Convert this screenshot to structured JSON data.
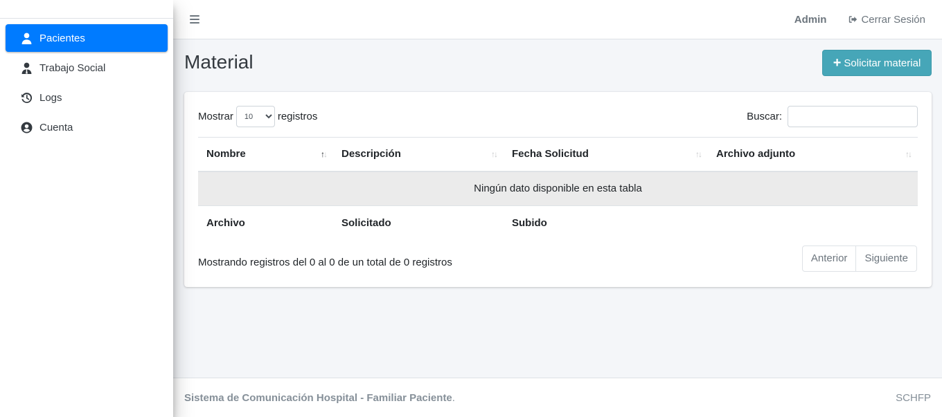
{
  "sidebar": {
    "items": [
      {
        "label": "Pacientes",
        "icon": "user-icon",
        "active": true
      },
      {
        "label": "Trabajo Social",
        "icon": "user-tie-icon",
        "active": false
      },
      {
        "label": "Logs",
        "icon": "history-icon",
        "active": false
      },
      {
        "label": "Cuenta",
        "icon": "user-circle-icon",
        "active": false
      }
    ]
  },
  "header": {
    "user": "Admin",
    "logout_label": "Cerrar Sesión"
  },
  "main": {
    "title": "Material",
    "request_button": "Solicitar material",
    "table": {
      "length_prefix": "Mostrar",
      "length_value": "10",
      "length_suffix": "registros",
      "search_label": "Buscar:",
      "search_value": "",
      "columns": [
        "Nombre",
        "Descripción",
        "Fecha Solicitud",
        "Archivo adjunto"
      ],
      "empty_message": "Ningún dato disponible en esta tabla",
      "footer_columns": [
        "Archivo",
        "Solicitado",
        "Subido"
      ],
      "info": "Mostrando registros del 0 al 0 de un total de 0 registros",
      "prev_label": "Anterior",
      "next_label": "Siguiente"
    }
  },
  "footer": {
    "left": "Sistema de Comunicación Hospital - Familiar Paciente",
    "left_suffix": ".",
    "right": "SCHFP"
  },
  "colors": {
    "accent": "#007bff",
    "info_button": "#46a6b8"
  }
}
